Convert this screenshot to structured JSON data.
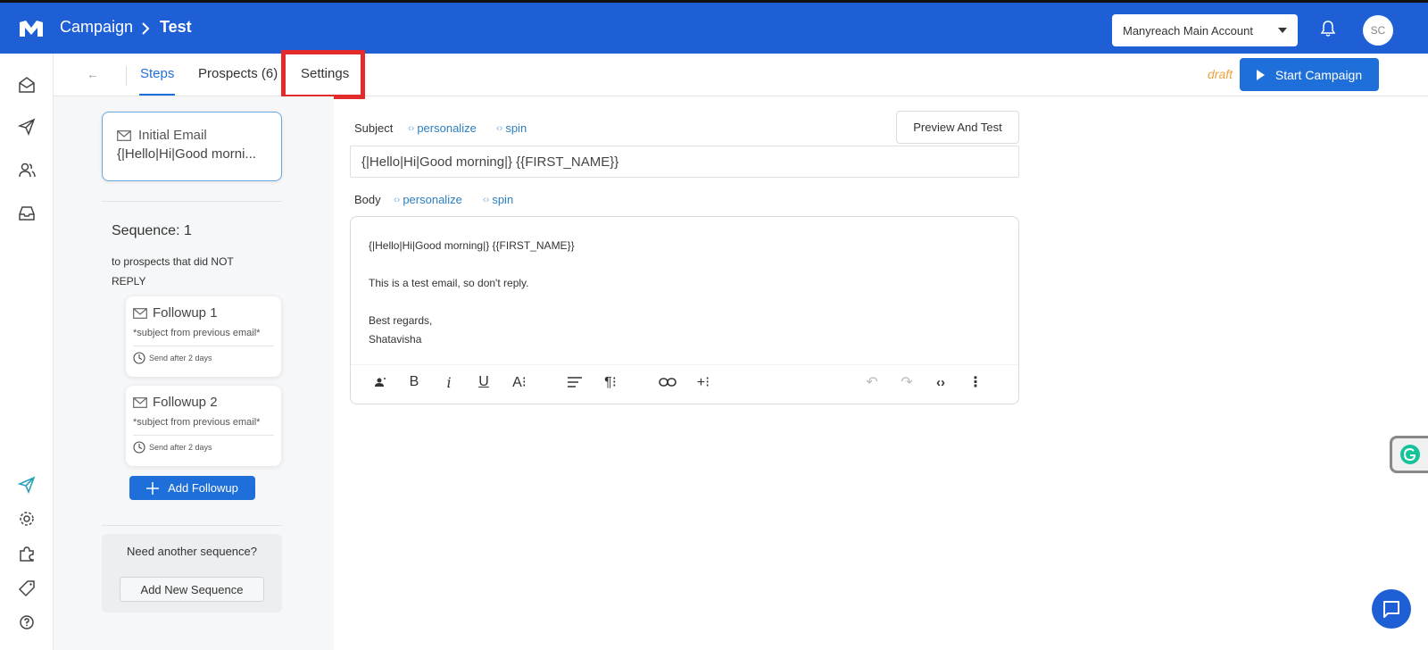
{
  "header": {
    "breadcrumb_parent": "Campaign",
    "breadcrumb_current": "Test",
    "account_label": "Manyreach Main Account",
    "avatar_initials": "SC"
  },
  "tabs": {
    "back": "←",
    "steps": "Steps",
    "prospects": "Prospects (6)",
    "settings": "Settings"
  },
  "status": "draft",
  "start_button": "Start Campaign",
  "steps_panel": {
    "initial_title": "Initial Email",
    "initial_preview": "{|Hello|Hi|Good morni...",
    "sequence_title": "Sequence: 1",
    "sequence_desc": "to prospects that did NOT REPLY",
    "followups": [
      {
        "title": "Followup 1",
        "subject": "*subject from previous email*",
        "send": "Send after 2 days"
      },
      {
        "title": "Followup 2",
        "subject": "*subject from previous email*",
        "send": "Send after 2 days"
      }
    ],
    "add_followup": "Add Followup",
    "need_another": "Need another sequence?",
    "add_sequence": "Add New Sequence"
  },
  "editor": {
    "subject_label": "Subject",
    "body_label": "Body",
    "personalize": "personalize",
    "spin": "spin",
    "preview_button": "Preview And Test",
    "subject_value": "{|Hello|Hi|Good morning|} {{FIRST_NAME}}",
    "body_lines": {
      "line1": "{|Hello|Hi|Good morning|} {{FIRST_NAME}}",
      "line2": "This is a test email, so don't reply.",
      "line3": "Best regards,",
      "line4": "Shatavisha"
    }
  },
  "colors": {
    "brand_blue": "#1e5fd6",
    "accent_blue": "#1e6fd9",
    "draft_orange": "#e8a33d",
    "highlight_red": "#e32b2b"
  }
}
